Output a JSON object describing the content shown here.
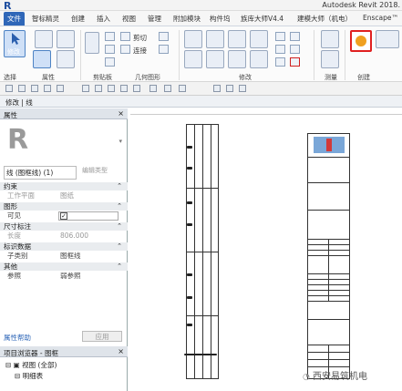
{
  "app": {
    "logo": "R",
    "title": "Autodesk Revit 2018."
  },
  "tabs": [
    {
      "label": "文件",
      "active": true
    },
    {
      "label": "智标精灵"
    },
    {
      "label": "创建"
    },
    {
      "label": "插入"
    },
    {
      "label": "视图"
    },
    {
      "label": "管理"
    },
    {
      "label": "附加模块"
    },
    {
      "label": "构件坞"
    },
    {
      "label": "族库大师V4.4"
    },
    {
      "label": "建模大师（机电）"
    },
    {
      "label": "Enscape™"
    }
  ],
  "ribbon": {
    "modify_label": "修改",
    "clipboard": {
      "cut": "剪切",
      "join": "连接"
    },
    "groups": [
      "选择",
      "属性",
      "剪贴板",
      "几何图形",
      "修改",
      "测量",
      "创建"
    ]
  },
  "mode_bar": "修改 | 线",
  "properties": {
    "header": "属性",
    "type_name": "线 (图框线) (1)",
    "edit_type": "编辑类型",
    "categories": {
      "constraints": "约束",
      "graphics": "图形",
      "dimensions": "尺寸标注",
      "identity": "标识数据",
      "other": "其他"
    },
    "rows": {
      "work_plane": {
        "key": "工作平面",
        "value": "图纸"
      },
      "visible": {
        "key": "可见"
      },
      "length": {
        "key": "长度",
        "value": "806.000"
      },
      "subcategory": {
        "key": "子类别",
        "value": "图框线"
      },
      "reference": {
        "key": "参照",
        "value": "弱参照"
      }
    },
    "help": "属性帮助",
    "apply": "应用"
  },
  "browser": {
    "header": "项目浏览器 - 图框",
    "node1": "视图 (全部)",
    "node2": "明细表"
  },
  "watermark": "西安易筑机电",
  "colors": {
    "accent": "#2f67b8",
    "highlight": "#e02020"
  }
}
